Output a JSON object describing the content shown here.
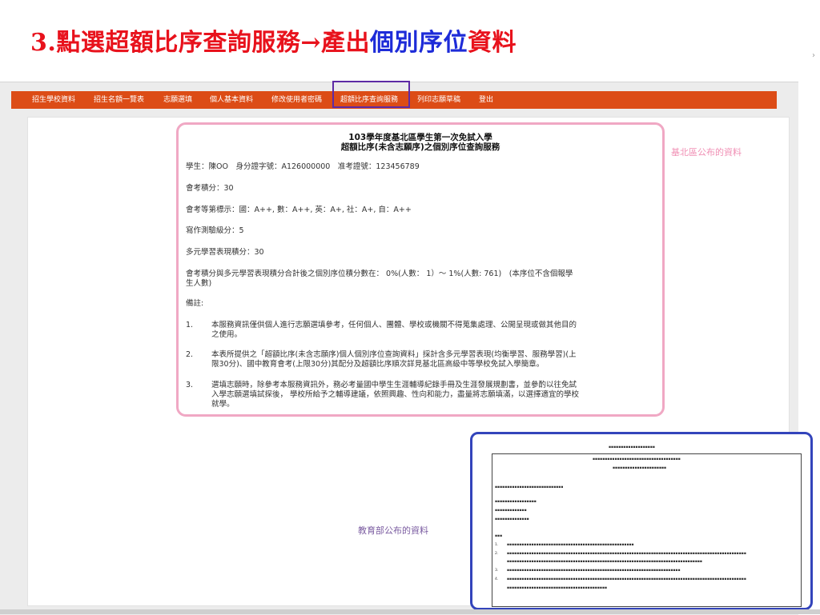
{
  "slide": {
    "title_red_1": "3.點選超額比序查詢服務→產出",
    "title_blue_1": "個別序位",
    "title_red_2": "資料"
  },
  "nav": {
    "items": [
      "招生學校資料",
      "招生名額一覽表",
      "志願選填",
      "個人基本資料",
      "修改使用者密碼",
      "超額比序查詢服務",
      "列印志願草稿",
      "登出"
    ]
  },
  "card": {
    "title1": "103學年度基北區學生第一次免試入學",
    "title2": "超額比序(未含志願序)之個別序位查詢服務",
    "student_line": "學生：陳OO　身分證字號：A126000000　准考證號：123456789",
    "score_line": "會考積分：30",
    "grades_line": "會考等第標示：國：A++, 數：A++, 英：A+, 社：A+, 自：A++",
    "writing_line": "寫作測驗級分：5",
    "diverse_line": "多元學習表現積分：30",
    "rank_line1": "會考積分與多元學習表現積分合計後之個別序位積分數在： 0%(人數： 1）～ 1%(人數: 761)　(本序位不含個報學",
    "rank_line2": "生人數)",
    "notes_label": "備註:",
    "notes": [
      {
        "num": "1.",
        "lines": [
          "本服務資訊僅供個人進行志願選填參考，任何個人、團體、學校或機關不得蒐集處理、公開呈現或做其他目的",
          "之使用。"
        ]
      },
      {
        "num": "2.",
        "lines": [
          "本表所提供之「超額比序(未含志願序)個人個別序位查詢資料」採計含多元學習表現(均衡學習、服務學習)(上",
          "限30分)、國中教育會考(上限30分)其配分及超額比序順次詳見基北區高級中等學校免試入學簡章。"
        ]
      },
      {
        "num": "3.",
        "lines": [
          "選填志願時，除參考本服務資訊外，務必考量國中學生生涯輔導紀錄手冊及生涯發展規劃書，並參酌以往免試",
          "入學志願選填試探後， 學校所給予之輔導建議，依照興趣、性向和能力，盡量將志願填滿，以選擇適宜的學校",
          "就學。"
        ]
      }
    ]
  },
  "labels": {
    "district": "基北區公布的資料",
    "moe": "教育部公布的資料"
  }
}
